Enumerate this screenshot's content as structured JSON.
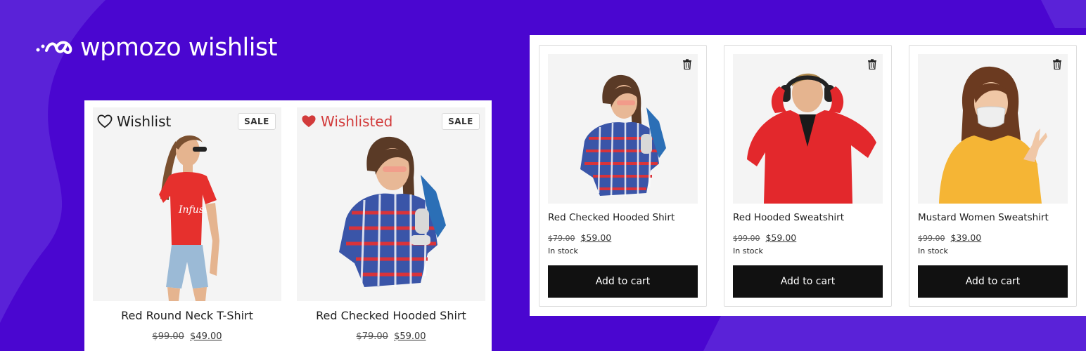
{
  "brand": {
    "name": "wpmozo wishlist"
  },
  "colors": {
    "background": "#4a06d0",
    "heart_active": "#d23b3b",
    "button": "#111111"
  },
  "product_cards": [
    {
      "wishlist_label": "Wishlist",
      "wishlisted": false,
      "badge": "SALE",
      "title": "Red Round Neck T-Shirt",
      "old_price": "$99.00",
      "price": "$49.00"
    },
    {
      "wishlist_label": "Wishlisted",
      "wishlisted": true,
      "badge": "SALE",
      "title": "Red Checked Hooded Shirt",
      "old_price": "$79.00",
      "price": "$59.00"
    }
  ],
  "wishlist_items": [
    {
      "title": "Red Checked Hooded Shirt",
      "old_price": "$79.00",
      "price": "$59.00",
      "stock": "In stock",
      "button_label": "Add to cart",
      "remove_icon": "trash-icon"
    },
    {
      "title": "Red Hooded Sweatshirt",
      "old_price": "$99.00",
      "price": "$59.00",
      "stock": "In stock",
      "button_label": "Add to cart",
      "remove_icon": "trash-icon"
    },
    {
      "title": "Mustard Women Sweatshirt",
      "old_price": "$99.00",
      "price": "$39.00",
      "stock": "In stock",
      "button_label": "Add to cart",
      "remove_icon": "trash-icon"
    }
  ]
}
